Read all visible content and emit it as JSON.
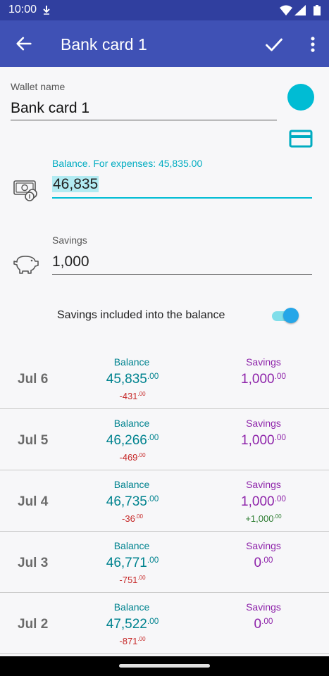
{
  "status_bar": {
    "time": "10:00"
  },
  "app_bar": {
    "title": "Bank card 1"
  },
  "wallet": {
    "name_label": "Wallet name",
    "name_value": "Bank card 1"
  },
  "balance": {
    "label": "Balance. For expenses: 45,835.00",
    "value": "46,835"
  },
  "savings": {
    "label": "Savings",
    "value": "1,000"
  },
  "toggle": {
    "label": "Savings included into the balance",
    "on": true
  },
  "history_rows": [
    {
      "date": "Jul 6",
      "balance_title": "Balance",
      "balance_int": "45,835",
      "balance_dec": ".00",
      "balance_diff_int": "-431",
      "balance_diff_dec": ".00",
      "savings_title": "Savings",
      "savings_int": "1,000",
      "savings_dec": ".00",
      "savings_diff_int": "",
      "savings_diff_dec": ""
    },
    {
      "date": "Jul 5",
      "balance_title": "Balance",
      "balance_int": "46,266",
      "balance_dec": ".00",
      "balance_diff_int": "-469",
      "balance_diff_dec": ".00",
      "savings_title": "Savings",
      "savings_int": "1,000",
      "savings_dec": ".00",
      "savings_diff_int": "",
      "savings_diff_dec": ""
    },
    {
      "date": "Jul 4",
      "balance_title": "Balance",
      "balance_int": "46,735",
      "balance_dec": ".00",
      "balance_diff_int": "-36",
      "balance_diff_dec": ".00",
      "savings_title": "Savings",
      "savings_int": "1,000",
      "savings_dec": ".00",
      "savings_diff_int": "+1,000",
      "savings_diff_dec": ".00"
    },
    {
      "date": "Jul 3",
      "balance_title": "Balance",
      "balance_int": "46,771",
      "balance_dec": ".00",
      "balance_diff_int": "-751",
      "balance_diff_dec": ".00",
      "savings_title": "Savings",
      "savings_int": "0",
      "savings_dec": ".00",
      "savings_diff_int": "",
      "savings_diff_dec": ""
    },
    {
      "date": "Jul 2",
      "balance_title": "Balance",
      "balance_int": "47,522",
      "balance_dec": ".00",
      "balance_diff_int": "-871",
      "balance_diff_dec": ".00",
      "savings_title": "Savings",
      "savings_int": "0",
      "savings_dec": ".00",
      "savings_diff_int": "",
      "savings_diff_dec": ""
    }
  ],
  "colors": {
    "status_bar": "#303f9f",
    "app_bar": "#3f51b5",
    "wallet_color": "#00bcd4",
    "balance": "#00838f",
    "savings": "#8e24aa",
    "negative": "#c62828",
    "positive": "#2e7d32"
  },
  "icons": {
    "back": "arrow-left-icon",
    "save": "check-icon",
    "more": "more-vertical-icon",
    "wallet_color": "color-circle-icon",
    "wallet_type": "credit-card-icon",
    "balance": "money-icon",
    "savings": "piggy-bank-icon"
  }
}
